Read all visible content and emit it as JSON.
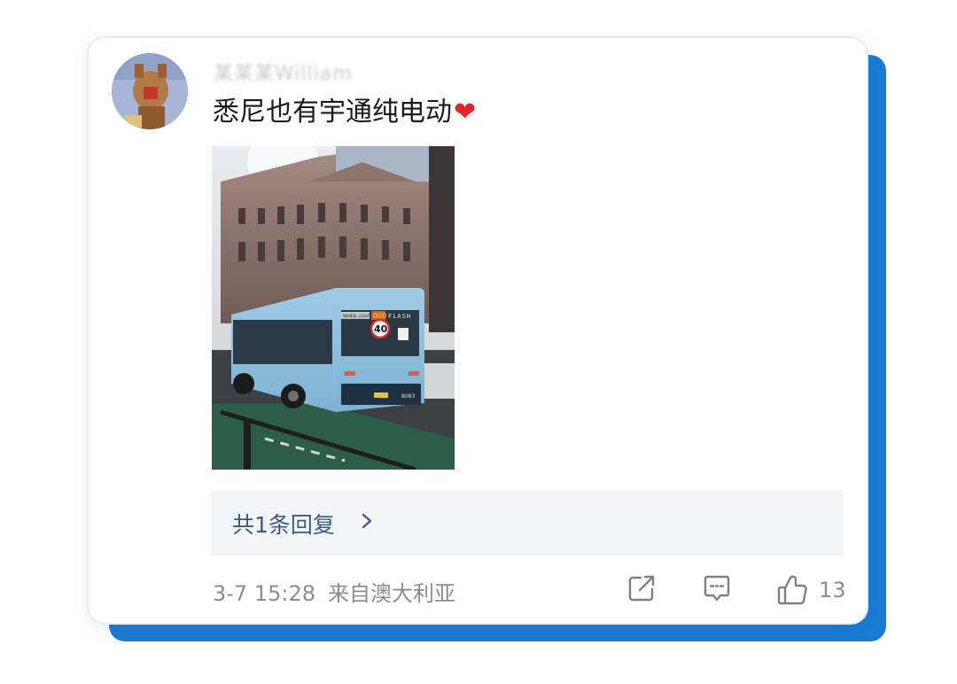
{
  "comment": {
    "username": "某某某William",
    "text": "悉尼也有宇通纯电动",
    "emoji": "❤"
  },
  "photo": {
    "bus_sign_left": "WHEN LIGHTS",
    "bus_sign_mid": "000",
    "bus_sign_right": "FLASH",
    "speed_limit": "40",
    "fleet_number": "8083"
  },
  "replies": {
    "label": "共1条回复"
  },
  "meta": {
    "date": "3-7 15:28",
    "location": "来自澳大利亚"
  },
  "actions": {
    "like_count": "13"
  },
  "colors": {
    "accent_shadow": "#1b7bd2",
    "reply_link": "#3b5b86",
    "heart": "#e1262d"
  }
}
